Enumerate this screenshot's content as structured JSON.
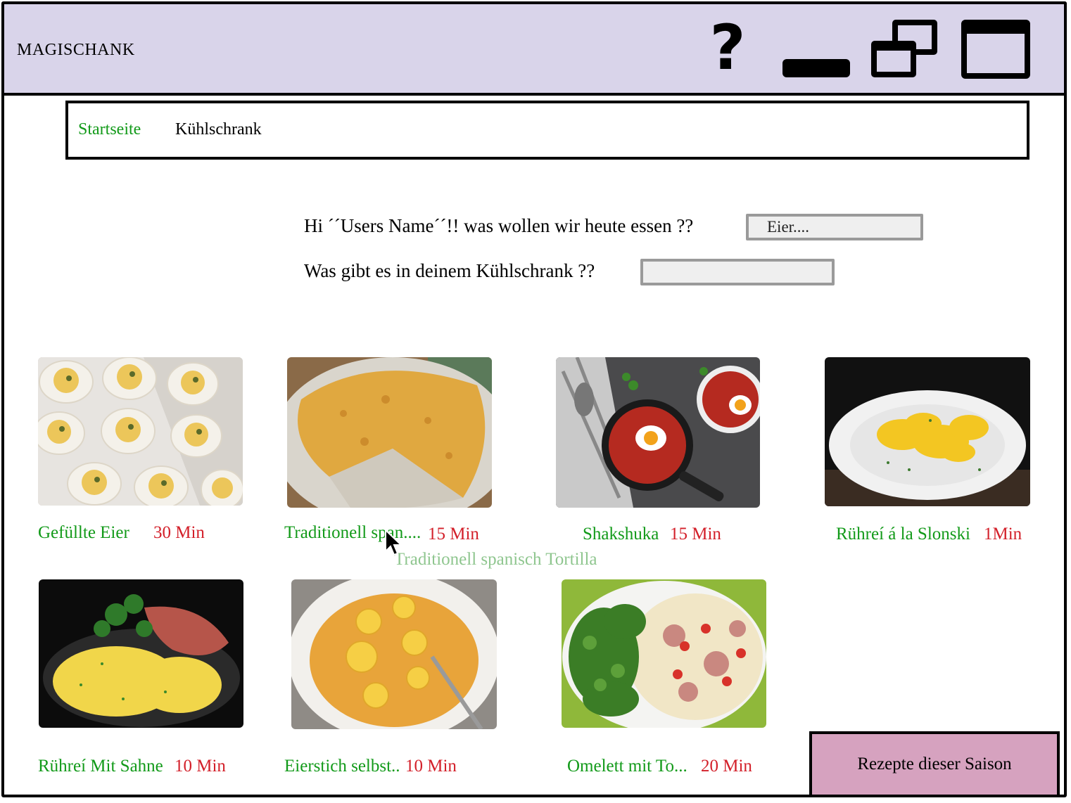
{
  "window": {
    "title": "MAGISCHANK",
    "help_glyph": "?",
    "icons": [
      "help-icon",
      "minimize-icon",
      "restore-icon",
      "maximize-icon"
    ]
  },
  "nav": {
    "items": [
      {
        "label": "Startseite",
        "active": true
      },
      {
        "label": "Kühlschrank",
        "active": false
      }
    ]
  },
  "search": {
    "greeting": "Hi ´´Users Name´´!! was wollen wir heute essen ??",
    "greeting_placeholder": "Eier....",
    "fridge_question": "Was gibt es in deinem Kühlschrank ??",
    "fridge_placeholder": ""
  },
  "recipes": [
    {
      "name": "Gefüllte Eier",
      "time": "30 Min"
    },
    {
      "name": "Traditionell span....",
      "time": "15 Min"
    },
    {
      "name": "Shakshuka",
      "time": "15 Min"
    },
    {
      "name": "Rühreí á la Slonski",
      "time": "1Min"
    },
    {
      "name": "Rühreí Mit Sahne",
      "time": "10 Min"
    },
    {
      "name": "Eierstich selbst..",
      "time": "10 Min"
    },
    {
      "name": "Omelett mit To...",
      "time": "20 Min"
    }
  ],
  "tooltip": "Traditionell spanisch Tortilla",
  "season_button": "Rezepte dieser Saison",
  "colors": {
    "titlebar": "#d9d4ea",
    "recipe_name": "#129a19",
    "recipe_time": "#d3202a",
    "tooltip": "#8fc68f",
    "season_button": "#d6a2bf"
  }
}
